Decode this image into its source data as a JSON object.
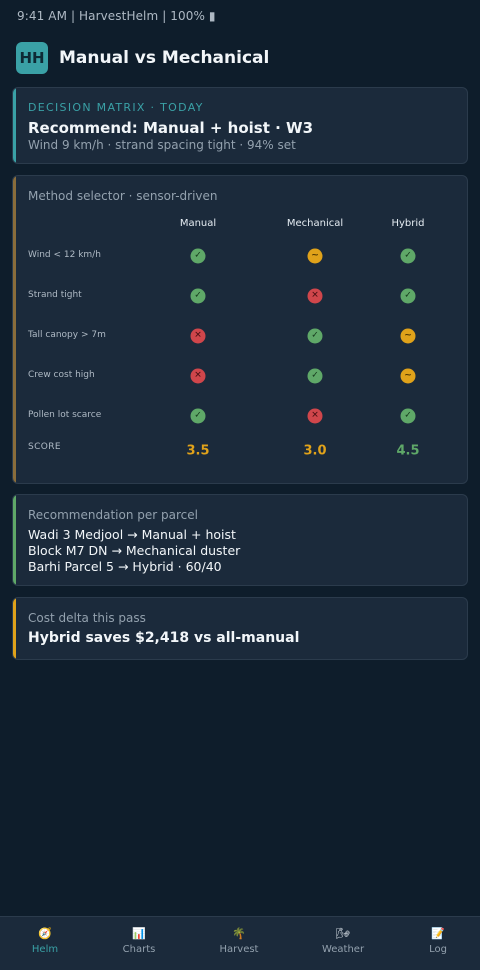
{
  "status_bar": {
    "text": "9:41 AM | HarvestHelm | 100% ▮"
  },
  "header": {
    "logo": "HH",
    "title": "Manual vs Mechanical"
  },
  "decision": {
    "kicker": "DECISION MATRIX · TODAY",
    "headline": "Recommend: Manual + hoist · W3",
    "subline": "Wind 9 km/h · strand spacing tight · 94% set"
  },
  "matrix": {
    "label": "Method selector · sensor-driven",
    "columns": [
      "Manual",
      "Mechanical",
      "Hybrid"
    ],
    "rows": [
      {
        "label": "Wind < 12 km/h",
        "marks": [
          "yes",
          "partial",
          "yes"
        ]
      },
      {
        "label": "Strand tight",
        "marks": [
          "yes",
          "no",
          "yes"
        ]
      },
      {
        "label": "Tall canopy > 7m",
        "marks": [
          "no",
          "yes",
          "partial"
        ]
      },
      {
        "label": "Crew cost high",
        "marks": [
          "no",
          "yes",
          "partial"
        ]
      },
      {
        "label": "Pollen lot scarce",
        "marks": [
          "yes",
          "no",
          "yes"
        ]
      }
    ],
    "score_label": "SCORE",
    "scores": [
      "3.5",
      "3.0",
      "4.5"
    ],
    "score_colors": [
      "#e0a21a",
      "#e0a21a",
      "#5fa868"
    ],
    "mark_glyphs": {
      "yes": "✓",
      "no": "✕",
      "partial": "~"
    }
  },
  "recommendation": {
    "label": "Recommendation per parcel",
    "lines": [
      "Wadi 3 Medjool → Manual + hoist",
      "Block M7 DN → Mechanical duster",
      "Barhi Parcel 5 → Hybrid · 60/40"
    ]
  },
  "cost": {
    "label": "Cost delta this pass",
    "value": "Hybrid saves $2,418 vs all-manual"
  },
  "tabs": [
    {
      "label": "Helm",
      "icon": "🧭",
      "icon_name": "compass-icon",
      "active": true
    },
    {
      "label": "Charts",
      "icon": "📊",
      "icon_name": "bar-chart-icon",
      "active": false
    },
    {
      "label": "Harvest",
      "icon": "🌴",
      "icon_name": "palm-tree-icon",
      "active": false
    },
    {
      "label": "Weather",
      "icon": "🌬",
      "icon_name": "wind-icon",
      "active": false
    },
    {
      "label": "Log",
      "icon": "📝",
      "icon_name": "memo-icon",
      "active": false
    }
  ],
  "colors": {
    "background": "#0e1d2b",
    "card": "#1b2a3b",
    "accent_teal": "#3aa1a6",
    "yes": "#5fa868",
    "no": "#d0464b",
    "partial": "#e0a21a"
  }
}
